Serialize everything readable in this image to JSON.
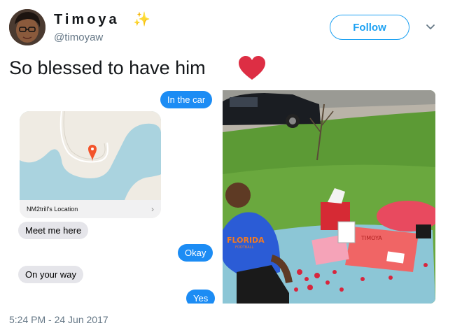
{
  "user": {
    "display_name": "Timoya",
    "handle": "@timoyaw",
    "avatar_icon": "avatar-photo",
    "sparkle_icon": "sparkles-emoji"
  },
  "actions": {
    "follow_label": "Follow",
    "more_icon": "chevron-down-icon"
  },
  "tweet": {
    "text": "So blessed to have him",
    "emoji": "red-heart-emoji",
    "timestamp": "5:24 PM - 24 Jun 2017"
  },
  "messages": {
    "in_the_car": "In the car",
    "location_label": "NM2trill's Location",
    "meet_me_here": "Meet me here",
    "okay": "Okay",
    "on_your_way": "On your way",
    "yes": "Yes"
  },
  "photo": {
    "shirt_text": "FLORIDA",
    "shirt_subtext": "FOOTBALL",
    "sign_text": "TIMOYA"
  },
  "colors": {
    "accent": "#1da1f2",
    "imessage_blue": "#1c8cf4",
    "imessage_gray": "#e5e5ea",
    "heart_red": "#dd2e44"
  }
}
